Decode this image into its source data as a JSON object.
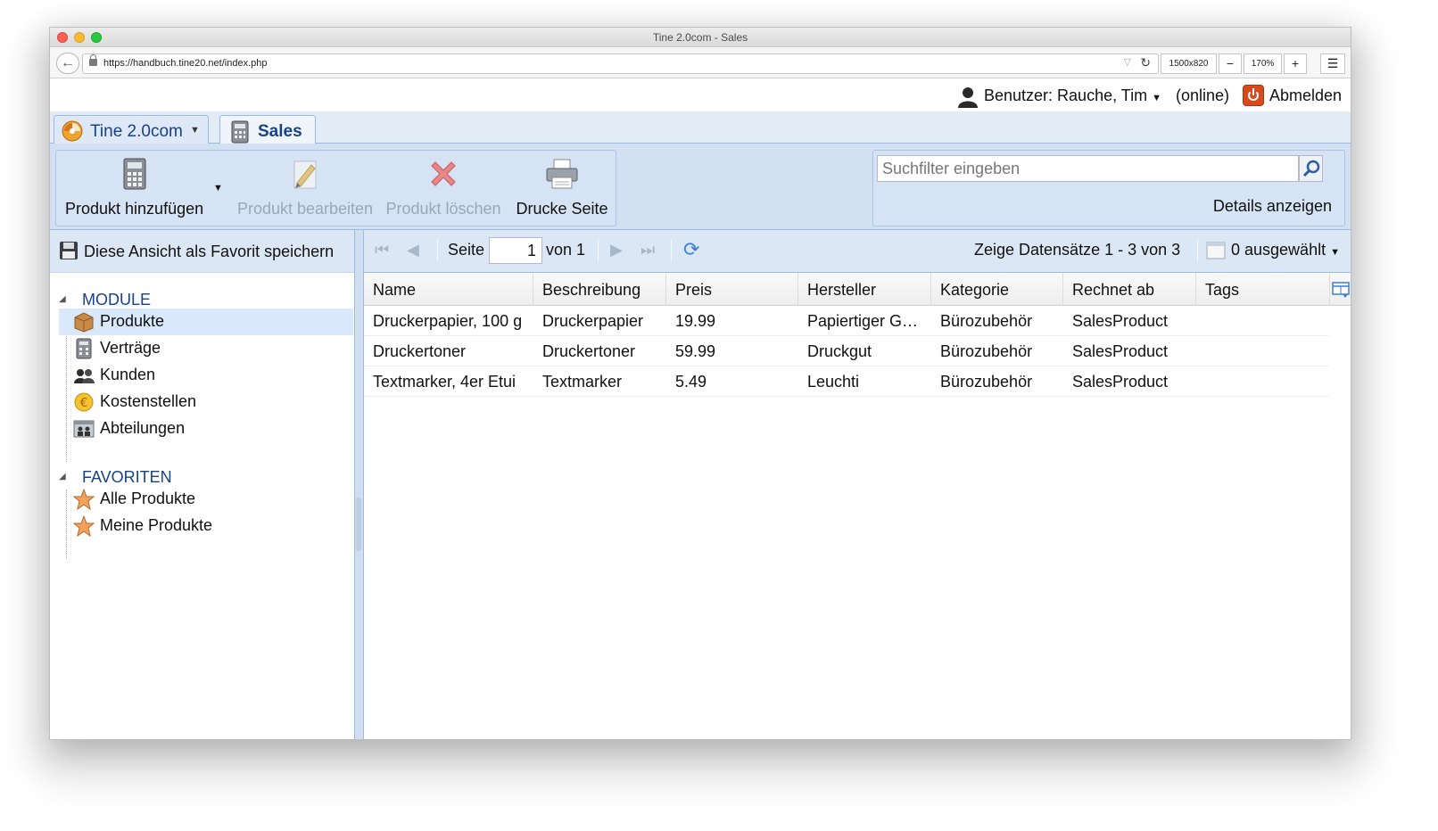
{
  "window": {
    "title": "Tine 2.0com - Sales"
  },
  "browser": {
    "url": "https://handbuch.tine20.net/index.php",
    "viewport_label": "1500x820",
    "zoom_out_label": "−",
    "zoom_level": "170%",
    "zoom_in_label": "+"
  },
  "userbar": {
    "user_label": "Benutzer: Rauche, Tim",
    "status": "(online)",
    "logout_label": "Abmelden"
  },
  "tabs": [
    {
      "label": "Tine 2.0com"
    },
    {
      "label": "Sales"
    }
  ],
  "toolbar": {
    "add_label": "Produkt hinzufügen",
    "edit_label": "Produkt bearbeiten",
    "delete_label": "Produkt löschen",
    "print_label": "Drucke Seite"
  },
  "search": {
    "placeholder": "Suchfilter eingeben",
    "details_label": "Details anzeigen"
  },
  "sidebar": {
    "save_favorite_label": "Diese Ansicht als Favorit speichern",
    "modules_title": "MODULE",
    "modules": [
      {
        "label": "Produkte",
        "icon": "box-icon"
      },
      {
        "label": "Verträge",
        "icon": "contract-calculator-icon"
      },
      {
        "label": "Kunden",
        "icon": "customers-icon"
      },
      {
        "label": "Kostenstellen",
        "icon": "cost-center-icon"
      },
      {
        "label": "Abteilungen",
        "icon": "departments-icon"
      }
    ],
    "favorites_title": "FAVORITEN",
    "favorites": [
      {
        "label": "Alle Produkte",
        "icon": "star-icon"
      },
      {
        "label": "Meine Produkte",
        "icon": "star-icon"
      }
    ]
  },
  "paging": {
    "page_label": "Seite",
    "page_value": "1",
    "of_label": "von 1",
    "records_label": "Zeige Datensätze 1 - 3 von 3",
    "selected_label": "0 ausgewählt"
  },
  "grid": {
    "columns": [
      "Name",
      "Beschreibung",
      "Preis",
      "Hersteller",
      "Kategorie",
      "Rechnet ab",
      "Tags"
    ],
    "rows": [
      [
        "Druckerpapier, 100 g",
        "Druckerpapier",
        "19.99",
        "Papiertiger G…",
        "Bürozubehör",
        "SalesProduct",
        ""
      ],
      [
        "Druckertoner",
        "Druckertoner",
        "59.99",
        "Druckgut",
        "Bürozubehör",
        "SalesProduct",
        ""
      ],
      [
        "Textmarker, 4er Etui",
        "Textmarker",
        "5.49",
        "Leuchti",
        "Bürozubehör",
        "SalesProduct",
        ""
      ]
    ]
  }
}
